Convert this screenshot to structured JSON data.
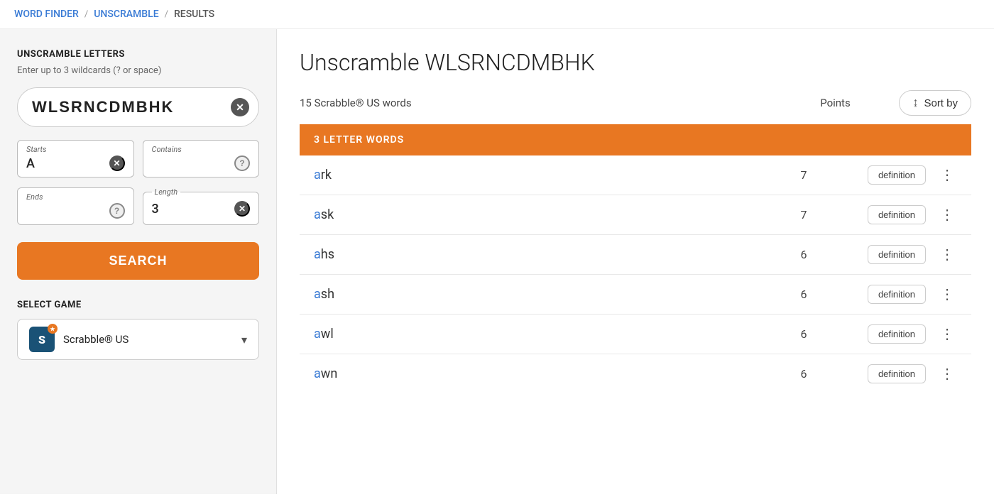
{
  "breadcrumb": {
    "items": [
      {
        "label": "WORD FINDER",
        "href": "#",
        "link": true
      },
      {
        "label": "UNSCRAMBLE",
        "href": "#",
        "link": true
      },
      {
        "label": "RESULTS",
        "link": false
      }
    ],
    "separators": [
      "/",
      "/"
    ]
  },
  "sidebar": {
    "title": "UNSCRAMBLE LETTERS",
    "subtitle": "Enter up to 3 wildcards (? or space)",
    "search_value": "WLSRNCDMBHK",
    "starts_label": "Starts",
    "starts_value": "A",
    "contains_label": "Contains",
    "ends_label": "Ends",
    "length_label": "Length",
    "length_value": "3",
    "search_button": "SEARCH",
    "select_game_label": "SELECT GAME",
    "game_name": "Scrabble® US",
    "game_logo": "S"
  },
  "results": {
    "title": "Unscramble WLSRNCDMBHK",
    "count_text": "15 Scrabble® US words",
    "points_label": "Points",
    "sort_label": "Sort by",
    "section_label": "3 LETTER WORDS",
    "words": [
      {
        "word": "ark",
        "first": "a",
        "rest": "rk",
        "points": 7
      },
      {
        "word": "ask",
        "first": "a",
        "rest": "sk",
        "points": 7
      },
      {
        "word": "ahs",
        "first": "a",
        "rest": "hs",
        "points": 6
      },
      {
        "word": "ash",
        "first": "a",
        "rest": "sh",
        "points": 6
      },
      {
        "word": "awl",
        "first": "a",
        "rest": "wl",
        "points": 6
      },
      {
        "word": "awn",
        "first": "a",
        "rest": "wn",
        "points": 6
      }
    ],
    "definition_btn_label": "definition"
  }
}
